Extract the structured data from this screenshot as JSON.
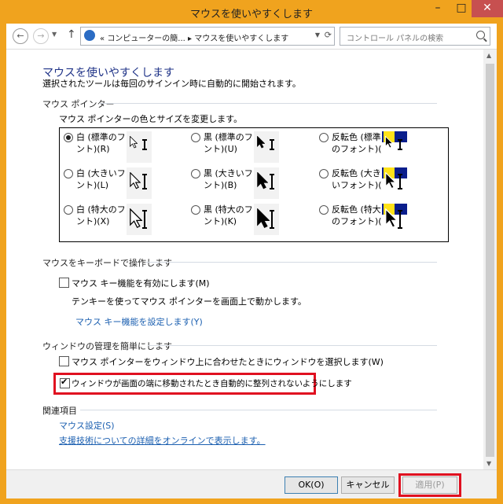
{
  "window": {
    "title": "マウスを使いやすくします",
    "controls": {
      "minimize": "–",
      "maximize": "□",
      "close": "✕"
    }
  },
  "nav": {
    "address_prefix": "«",
    "address_path_1": "コンピューターの簡...",
    "address_sep": "▸",
    "address_path_2": "マウスを使いやすくします",
    "search_placeholder": "コントロール パネルの検索"
  },
  "page": {
    "title": "マウスを使いやすくします",
    "subtitle": "選択されたツールは毎回のサインイン時に自動的に開始されます。"
  },
  "pointer_section": {
    "header": "マウス ポインター",
    "desc": "マウス ポインターの色とサイズを変更します。",
    "options": [
      {
        "label_1": "白 (標準のフォ",
        "label_2": "ント)(R)",
        "selected": true,
        "style": "white",
        "size": 1
      },
      {
        "label_1": "黒 (標準のフォ",
        "label_2": "ント)(U)",
        "selected": false,
        "style": "black",
        "size": 1
      },
      {
        "label_1": "反転色 (標準",
        "label_2": "のフォント)(G)",
        "selected": false,
        "style": "inverted",
        "size": 1
      },
      {
        "label_1": "白 (大きいフォ",
        "label_2": "ント)(L)",
        "selected": false,
        "style": "white",
        "size": 2
      },
      {
        "label_1": "黒 (大きいフォ",
        "label_2": "ント)(B)",
        "selected": false,
        "style": "black",
        "size": 2
      },
      {
        "label_1": "反転色 (大き",
        "label_2": "いフォント)(I)",
        "selected": false,
        "style": "inverted",
        "size": 2
      },
      {
        "label_1": "白 (特大のフォ",
        "label_2": "ント)(X)",
        "selected": false,
        "style": "white",
        "size": 3
      },
      {
        "label_1": "黒 (特大のフォ",
        "label_2": "ント)(K)",
        "selected": false,
        "style": "black",
        "size": 3
      },
      {
        "label_1": "反転色 (特大",
        "label_2": "のフォント)(N)",
        "selected": false,
        "style": "inverted",
        "size": 3
      }
    ]
  },
  "keyboard_section": {
    "header": "マウスをキーボードで操作します",
    "mousekeys_label": "マウス キー機能を有効にします(M)",
    "mousekeys_checked": false,
    "mousekeys_desc": "テンキーを使ってマウス ポインターを画面上で動かします。",
    "mousekeys_link": "マウス キー機能を設定します(Y)"
  },
  "window_section": {
    "header": "ウィンドウの管理を簡単にします",
    "hover_label": "マウス ポインターをウィンドウ上に合わせたときにウィンドウを選択します(W)",
    "hover_checked": false,
    "snap_label": "ウィンドウが画面の端に移動されたとき自動的に整列されないようにします",
    "snap_checked": true
  },
  "related_section": {
    "header": "関連項目",
    "link_1": "マウス設定(S)",
    "link_2": "支援技術についての詳細をオンラインで表示します。"
  },
  "footer": {
    "ok": "OK(O)",
    "cancel": "キャンセル",
    "apply": "適用(P)"
  },
  "colors": {
    "title_bar": "#f0a31e",
    "title_text": "#1e3287",
    "link": "#1b5fb0",
    "highlight_border": "#e01020",
    "close_button": "#c75050"
  }
}
